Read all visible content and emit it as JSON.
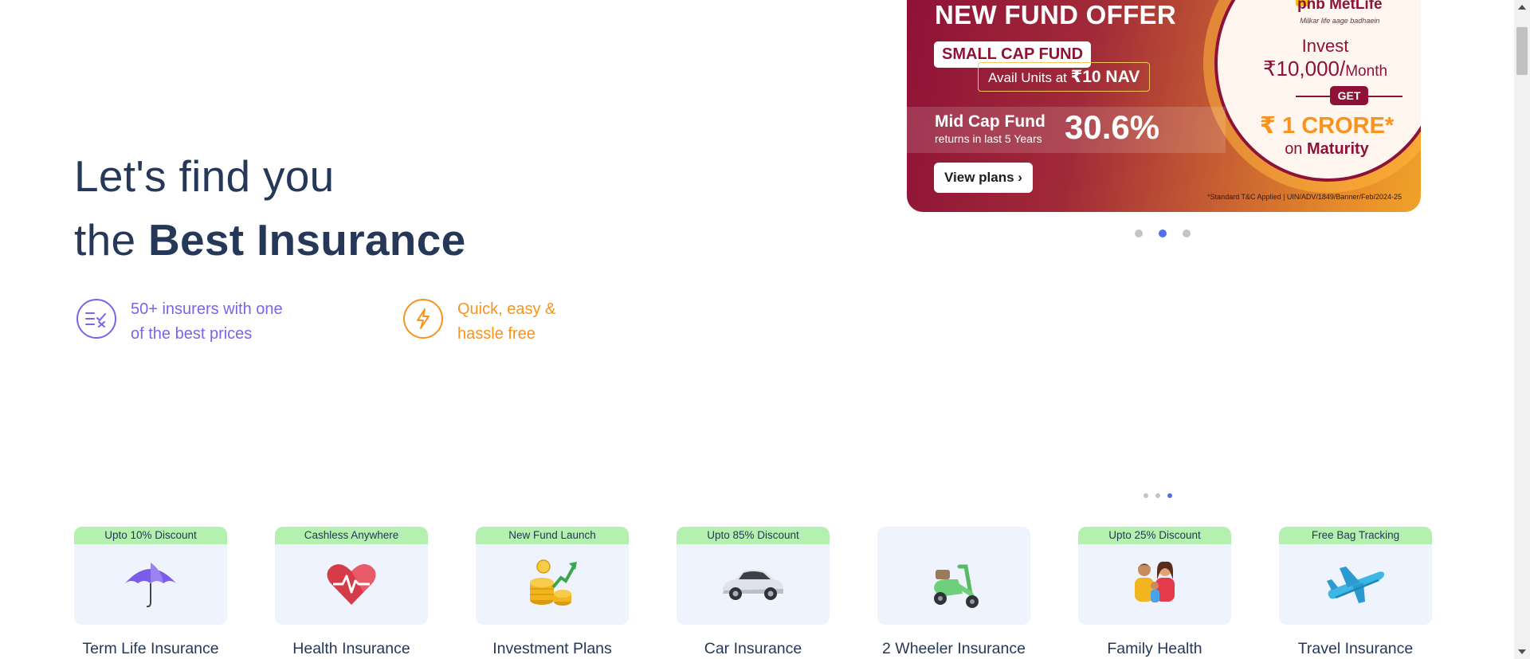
{
  "hero": {
    "line1": "Let's find you",
    "line2_prefix": "the ",
    "line2_bold": "Best Insurance"
  },
  "features": [
    {
      "icon": "compare-list-icon",
      "text_line1": "50+ insurers with one",
      "text_line2": "of the best prices",
      "color": "#7b63ea"
    },
    {
      "icon": "lightning-icon",
      "text_line1": "Quick, easy &",
      "text_line2": "hassle free",
      "color": "#f7931e"
    }
  ],
  "banner": {
    "headline": "NEW FUND OFFER",
    "fund_name": "SMALL CAP FUND",
    "avail_prefix": "Avail Units at ",
    "avail_value": "₹10 NAV",
    "midcap_title": "Mid Cap Fund",
    "midcap_sub": "returns in last 5 Years",
    "midcap_return": "30.6%",
    "cta": "View plans ›",
    "disclaimer": "*Standard T&C Applied | UIN/ADV/1849/Banner/Feb/2024-25",
    "brand": "pnb MetLife",
    "brand_tagline": "Milkar life aage badhaein",
    "invest_label": "Invest",
    "invest_amount": "₹10,000/",
    "invest_period": "Month",
    "get_label": "GET",
    "crore": "₹ 1 CRORE*",
    "maturity_prefix": "on ",
    "maturity_bold": "Maturity"
  },
  "carousel_main": {
    "count": 3,
    "active_index": 1
  },
  "carousel_products": {
    "count": 3,
    "active_index": 2
  },
  "products": [
    {
      "badge": "Upto 10% Discount",
      "name": "Term Life Insurance",
      "icon": "umbrella-icon"
    },
    {
      "badge": "Cashless Anywhere",
      "name": "Health Insurance",
      "icon": "heart-pulse-icon"
    },
    {
      "badge": "New Fund Launch",
      "name": "Investment Plans",
      "icon": "coins-growth-icon"
    },
    {
      "badge": "Upto 85% Discount",
      "name": "Car Insurance",
      "icon": "car-icon"
    },
    {
      "badge": "",
      "name": "2 Wheeler Insurance",
      "icon": "scooter-icon"
    },
    {
      "badge": "Upto 25% Discount",
      "name": "Family Health",
      "icon": "family-icon"
    },
    {
      "badge": "Free Bag Tracking",
      "name": "Travel Insurance",
      "icon": "airplane-icon"
    }
  ],
  "colors": {
    "primary_text": "#253858",
    "accent_purple": "#7b63ea",
    "accent_orange": "#f7931e",
    "badge_green": "#b4f1b0",
    "card_bg": "#eef3fd",
    "dot_active": "#4f6ff0",
    "banner_maroon": "#8e1237"
  }
}
